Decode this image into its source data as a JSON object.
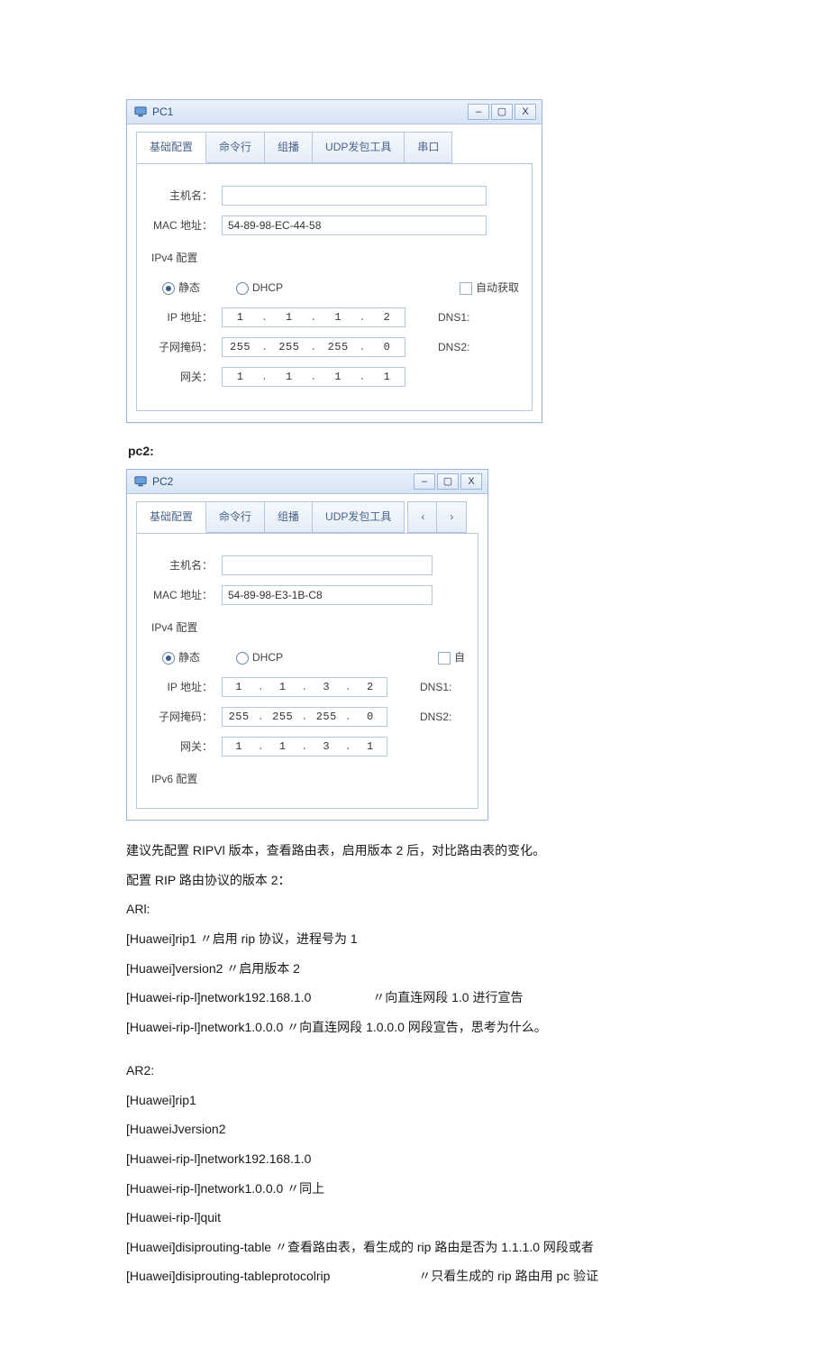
{
  "pc1": {
    "title": "PC1",
    "tabs": [
      "基础配置",
      "命令行",
      "组播",
      "UDP发包工具",
      "串口"
    ],
    "labels": {
      "host": "主机名：",
      "mac": "MAC 地址：",
      "section": "IPv4 配置",
      "radio_static": "静态",
      "radio_dhcp": "DHCP",
      "auto": "自动获取",
      "ip": "IP 地址：",
      "mask": "子网掩码：",
      "gw": "网关：",
      "dns1": "DNS1:",
      "dns2": "DNS2:"
    },
    "values": {
      "host": "",
      "mac": "54-89-98-EC-44-58",
      "ip": [
        "1",
        "1",
        "1",
        "2"
      ],
      "mask": [
        "255",
        "255",
        "255",
        "0"
      ],
      "gw": [
        "1",
        "1",
        "1",
        "1"
      ]
    }
  },
  "pc2_caption": "pc2:",
  "pc2": {
    "title": "PC2",
    "tabs": [
      "基础配置",
      "命令行",
      "组播",
      "UDP发包工具"
    ],
    "labels": {
      "host": "主机名：",
      "mac": "MAC 地址：",
      "section": "IPv4 配置",
      "radio_static": "静态",
      "radio_dhcp": "DHCP",
      "auto": "自",
      "ip": "IP 地址：",
      "mask": "子网掩码：",
      "gw": "网关：",
      "dns1": "DNS1:",
      "dns2": "DNS2:",
      "section6": "IPv6 配置"
    },
    "values": {
      "host": "",
      "mac": "54-89-98-E3-1B-C8",
      "ip": [
        "1",
        "1",
        "3",
        "2"
      ],
      "mask": [
        "255",
        "255",
        "255",
        "0"
      ],
      "gw": [
        "1",
        "1",
        "3",
        "1"
      ]
    }
  },
  "text": {
    "advice": "建议先配置 RIPVl 版本，查看路由表，启用版本 2 后，对比路由表的变化。",
    "cfg_header": "配置 RIP 路由协议的版本 2：",
    "ar1_hdr": "ARl:",
    "ar1_l1": "[Huawei]rip1 〃启用 rip 协议，进程号为 1",
    "ar1_l2": "[Huawei]version2 〃启用版本 2",
    "ar1_l3_cmd": "[Huawei-rip-l]network192.168.1.0",
    "ar1_l3_note": "〃向直连网段 1.0 进行宣告",
    "ar1_l4": "[Huawei-rip-l]network1.0.0.0 〃向直连网段 1.0.0.0 网段宣告，思考为什么。",
    "ar2_hdr": "AR2:",
    "ar2_l1": "[Huawei]rip1",
    "ar2_l2": "[HuaweiJversion2",
    "ar2_l3": "[Huawei-rip-l]network192.168.1.0",
    "ar2_l4": "[Huawei-rip-l]network1.0.0.0 〃同上",
    "ar2_l5": "[Huawei-rip-l]quit",
    "ar2_l6": "[Huawei]disiprouting-table 〃查看路由表，看生成的 rip 路由是否为 1.1.1.0 网段或者",
    "ar2_l7_cmd": "[Huawei]disiprouting-tableprotocolrip",
    "ar2_l7_note": "〃只看生成的 rip 路由用 pc 验证"
  }
}
